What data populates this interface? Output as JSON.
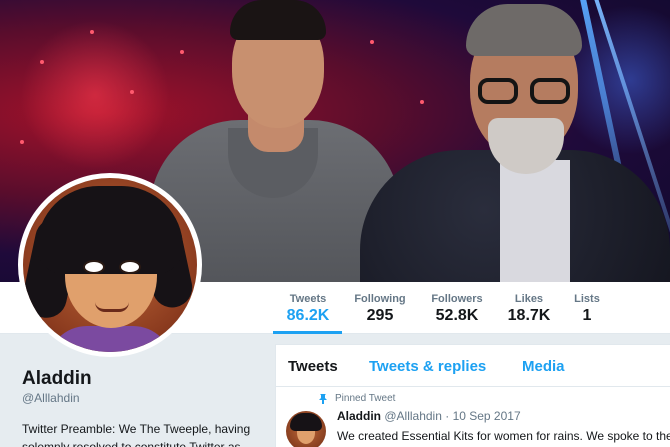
{
  "profile": {
    "name": "Aladdin",
    "handle": "@Alllahdin",
    "bio": "Twitter Preamble: We The Tweeple, having solemnly resolved to constitute Twitter as"
  },
  "stats": [
    {
      "label": "Tweets",
      "value": "86.2K"
    },
    {
      "label": "Following",
      "value": "295"
    },
    {
      "label": "Followers",
      "value": "52.8K"
    },
    {
      "label": "Likes",
      "value": "18.7K"
    },
    {
      "label": "Lists",
      "value": "1"
    }
  ],
  "timeline": {
    "tabs": [
      "Tweets",
      "Tweets & replies",
      "Media"
    ],
    "pinned_label": "Pinned Tweet",
    "tweet": {
      "author": "Aladdin",
      "handle": "@Alllahdin",
      "date": "· 10 Sep 2017",
      "text": "We created Essential Kits for women for rains. We spoke to the"
    }
  },
  "colors": {
    "accent": "#1da1f2",
    "text": "#14171a",
    "muted": "#657786",
    "background": "#e6ecf0"
  },
  "icons": [
    "pin-icon"
  ]
}
